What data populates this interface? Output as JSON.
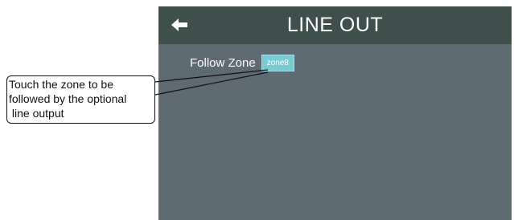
{
  "screen": {
    "title": "LINE OUT",
    "back_icon": "arrow-left-icon",
    "follow_zone": {
      "label": "Follow Zone",
      "value": "zone8"
    }
  },
  "callout": {
    "lines": [
      "Touch the zone to be",
      "followed by the optional",
      " line output"
    ]
  },
  "colors": {
    "header": "#3e4f4c",
    "screen": "#5e6b72",
    "zone_button": "#79cbd3"
  }
}
